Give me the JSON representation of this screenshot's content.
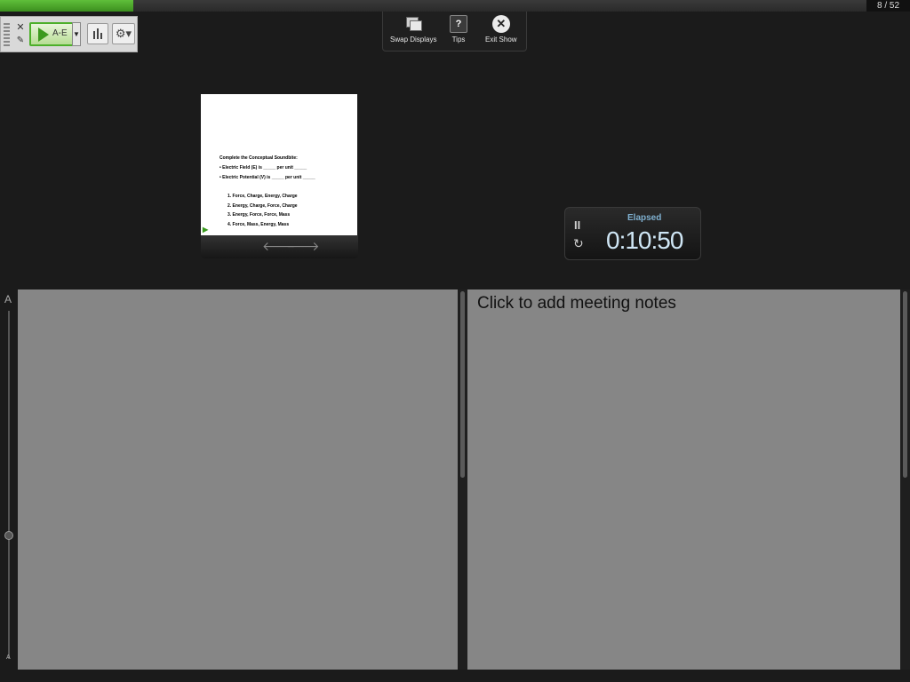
{
  "progress": {
    "current": 8,
    "total": 52,
    "label": "8 / 52",
    "fill_color": "#4caf2a"
  },
  "toolbar": {
    "close_icon": "close-icon",
    "edit_icon": "edit-icon",
    "poll_button_label": "A-E",
    "poll_icon": "play-icon",
    "chart_icon": "bar-chart-icon",
    "settings_icon": "gear-icon"
  },
  "top_controls": {
    "swap_label": "Swap Displays",
    "tips_label": "Tips",
    "tips_glyph": "?",
    "exit_label": "Exit Show",
    "exit_glyph": "✕"
  },
  "slide": {
    "heading": "Complete the Conceptual Soundbite:",
    "bullets": [
      "•   Electric Field (E) is _____ per unit _____",
      "•   Electric Potential (V) is _____ per unit _____"
    ],
    "options": [
      "1.  Force, Charge, Energy, Charge",
      "2. Energy, Charge, Force, Charge",
      "3. Energy, Force, Force, Mass",
      "4. Force, Mass, Energy, Mass"
    ],
    "prev_glyph": "🡐",
    "next_glyph": "🡒"
  },
  "timer": {
    "label": "Elapsed",
    "value": "0:10:50",
    "pause_glyph": "II",
    "reset_glyph": "↻"
  },
  "font_slider": {
    "top_label": "A",
    "bottom_label": "A"
  },
  "notes": {
    "placeholder": "Click to add meeting notes"
  }
}
